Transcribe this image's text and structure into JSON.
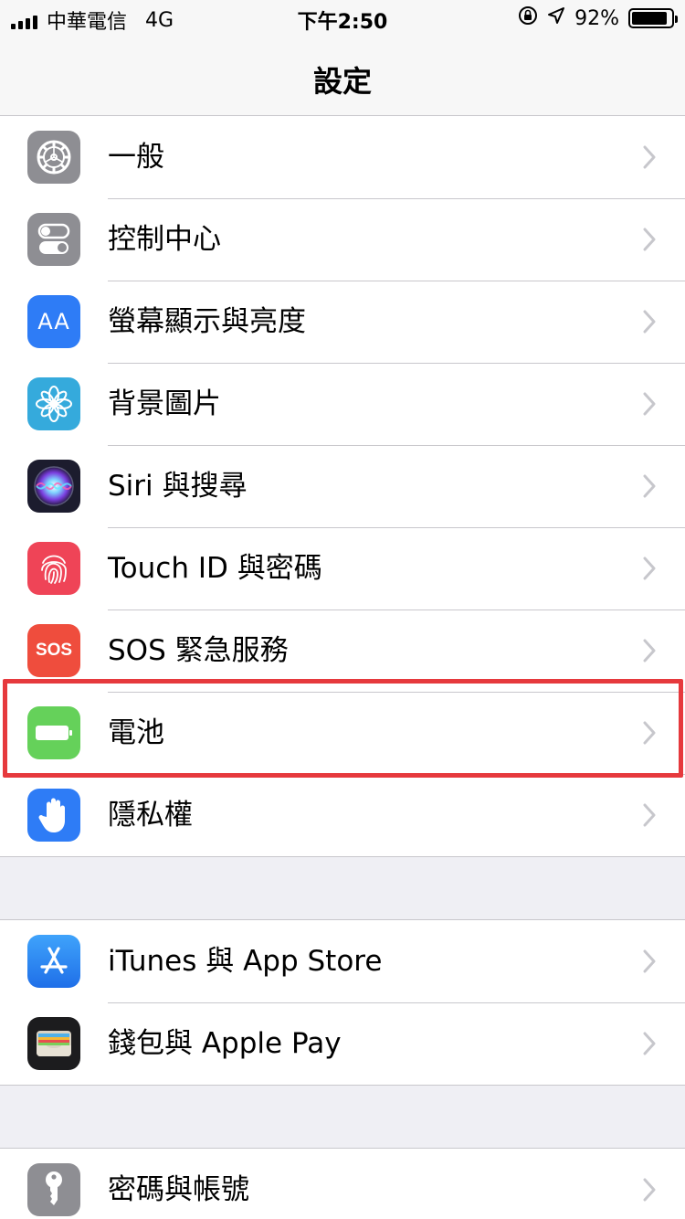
{
  "status_bar": {
    "carrier": "中華電信",
    "network": "4G",
    "time": "下午2:50",
    "battery_percent": "92%"
  },
  "nav": {
    "title": "設定"
  },
  "colors": {
    "general": "#8e8e93",
    "control": "#8e8e93",
    "display": "#2e7cf6",
    "wallpaper": "#35aadc",
    "siri": "#1c1c2e",
    "touch": "#ef4457",
    "sos": "#ef4d3d",
    "battery": "#65d15a",
    "privacy": "#2e7cf6",
    "appstore": "#2f8ff7",
    "wallet": "#1c1c1e",
    "passwords": "#8e8e93",
    "highlight": "#e6393d"
  },
  "groups": [
    {
      "items": [
        {
          "label": "一般",
          "icon": "gear-icon"
        },
        {
          "label": "控制中心",
          "icon": "toggles-icon"
        },
        {
          "label": "螢幕顯示與亮度",
          "icon": "text-size-icon",
          "icon_text": "AA"
        },
        {
          "label": "背景圖片",
          "icon": "flower-icon"
        },
        {
          "label": "Siri 與搜尋",
          "icon": "siri-icon"
        },
        {
          "label": "Touch ID 與密碼",
          "icon": "fingerprint-icon"
        },
        {
          "label": "SOS 緊急服務",
          "icon": "sos-icon",
          "icon_text": "SOS"
        },
        {
          "label": "電池",
          "icon": "battery-icon"
        },
        {
          "label": "隱私權",
          "icon": "hand-icon"
        }
      ]
    },
    {
      "items": [
        {
          "label": "iTunes 與 App Store",
          "icon": "app-store-icon"
        },
        {
          "label": "錢包與 Apple Pay",
          "icon": "wallet-icon"
        }
      ]
    },
    {
      "items": [
        {
          "label": "密碼與帳號",
          "icon": "key-icon"
        }
      ]
    }
  ]
}
